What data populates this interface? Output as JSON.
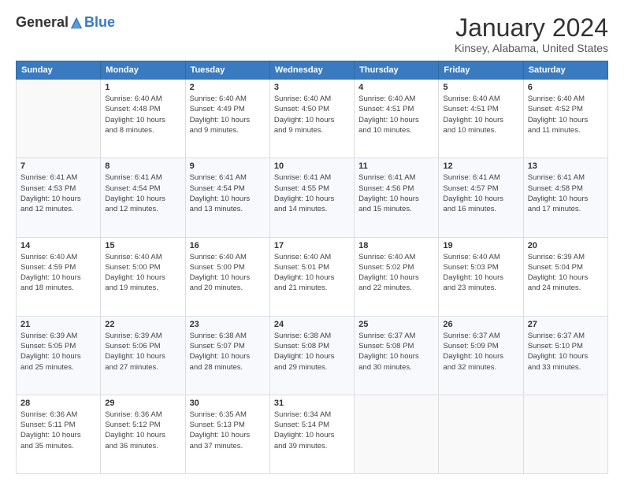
{
  "logo": {
    "general": "General",
    "blue": "Blue"
  },
  "title": "January 2024",
  "subtitle": "Kinsey, Alabama, United States",
  "days_header": [
    "Sunday",
    "Monday",
    "Tuesday",
    "Wednesday",
    "Thursday",
    "Friday",
    "Saturday"
  ],
  "weeks": [
    [
      {
        "num": "",
        "info": ""
      },
      {
        "num": "1",
        "info": "Sunrise: 6:40 AM\nSunset: 4:48 PM\nDaylight: 10 hours\nand 8 minutes."
      },
      {
        "num": "2",
        "info": "Sunrise: 6:40 AM\nSunset: 4:49 PM\nDaylight: 10 hours\nand 9 minutes."
      },
      {
        "num": "3",
        "info": "Sunrise: 6:40 AM\nSunset: 4:50 PM\nDaylight: 10 hours\nand 9 minutes."
      },
      {
        "num": "4",
        "info": "Sunrise: 6:40 AM\nSunset: 4:51 PM\nDaylight: 10 hours\nand 10 minutes."
      },
      {
        "num": "5",
        "info": "Sunrise: 6:40 AM\nSunset: 4:51 PM\nDaylight: 10 hours\nand 10 minutes."
      },
      {
        "num": "6",
        "info": "Sunrise: 6:40 AM\nSunset: 4:52 PM\nDaylight: 10 hours\nand 11 minutes."
      }
    ],
    [
      {
        "num": "7",
        "info": "Sunrise: 6:41 AM\nSunset: 4:53 PM\nDaylight: 10 hours\nand 12 minutes."
      },
      {
        "num": "8",
        "info": "Sunrise: 6:41 AM\nSunset: 4:54 PM\nDaylight: 10 hours\nand 12 minutes."
      },
      {
        "num": "9",
        "info": "Sunrise: 6:41 AM\nSunset: 4:54 PM\nDaylight: 10 hours\nand 13 minutes."
      },
      {
        "num": "10",
        "info": "Sunrise: 6:41 AM\nSunset: 4:55 PM\nDaylight: 10 hours\nand 14 minutes."
      },
      {
        "num": "11",
        "info": "Sunrise: 6:41 AM\nSunset: 4:56 PM\nDaylight: 10 hours\nand 15 minutes."
      },
      {
        "num": "12",
        "info": "Sunrise: 6:41 AM\nSunset: 4:57 PM\nDaylight: 10 hours\nand 16 minutes."
      },
      {
        "num": "13",
        "info": "Sunrise: 6:41 AM\nSunset: 4:58 PM\nDaylight: 10 hours\nand 17 minutes."
      }
    ],
    [
      {
        "num": "14",
        "info": "Sunrise: 6:40 AM\nSunset: 4:59 PM\nDaylight: 10 hours\nand 18 minutes."
      },
      {
        "num": "15",
        "info": "Sunrise: 6:40 AM\nSunset: 5:00 PM\nDaylight: 10 hours\nand 19 minutes."
      },
      {
        "num": "16",
        "info": "Sunrise: 6:40 AM\nSunset: 5:00 PM\nDaylight: 10 hours\nand 20 minutes."
      },
      {
        "num": "17",
        "info": "Sunrise: 6:40 AM\nSunset: 5:01 PM\nDaylight: 10 hours\nand 21 minutes."
      },
      {
        "num": "18",
        "info": "Sunrise: 6:40 AM\nSunset: 5:02 PM\nDaylight: 10 hours\nand 22 minutes."
      },
      {
        "num": "19",
        "info": "Sunrise: 6:40 AM\nSunset: 5:03 PM\nDaylight: 10 hours\nand 23 minutes."
      },
      {
        "num": "20",
        "info": "Sunrise: 6:39 AM\nSunset: 5:04 PM\nDaylight: 10 hours\nand 24 minutes."
      }
    ],
    [
      {
        "num": "21",
        "info": "Sunrise: 6:39 AM\nSunset: 5:05 PM\nDaylight: 10 hours\nand 25 minutes."
      },
      {
        "num": "22",
        "info": "Sunrise: 6:39 AM\nSunset: 5:06 PM\nDaylight: 10 hours\nand 27 minutes."
      },
      {
        "num": "23",
        "info": "Sunrise: 6:38 AM\nSunset: 5:07 PM\nDaylight: 10 hours\nand 28 minutes."
      },
      {
        "num": "24",
        "info": "Sunrise: 6:38 AM\nSunset: 5:08 PM\nDaylight: 10 hours\nand 29 minutes."
      },
      {
        "num": "25",
        "info": "Sunrise: 6:37 AM\nSunset: 5:08 PM\nDaylight: 10 hours\nand 30 minutes."
      },
      {
        "num": "26",
        "info": "Sunrise: 6:37 AM\nSunset: 5:09 PM\nDaylight: 10 hours\nand 32 minutes."
      },
      {
        "num": "27",
        "info": "Sunrise: 6:37 AM\nSunset: 5:10 PM\nDaylight: 10 hours\nand 33 minutes."
      }
    ],
    [
      {
        "num": "28",
        "info": "Sunrise: 6:36 AM\nSunset: 5:11 PM\nDaylight: 10 hours\nand 35 minutes."
      },
      {
        "num": "29",
        "info": "Sunrise: 6:36 AM\nSunset: 5:12 PM\nDaylight: 10 hours\nand 36 minutes."
      },
      {
        "num": "30",
        "info": "Sunrise: 6:35 AM\nSunset: 5:13 PM\nDaylight: 10 hours\nand 37 minutes."
      },
      {
        "num": "31",
        "info": "Sunrise: 6:34 AM\nSunset: 5:14 PM\nDaylight: 10 hours\nand 39 minutes."
      },
      {
        "num": "",
        "info": ""
      },
      {
        "num": "",
        "info": ""
      },
      {
        "num": "",
        "info": ""
      }
    ]
  ]
}
